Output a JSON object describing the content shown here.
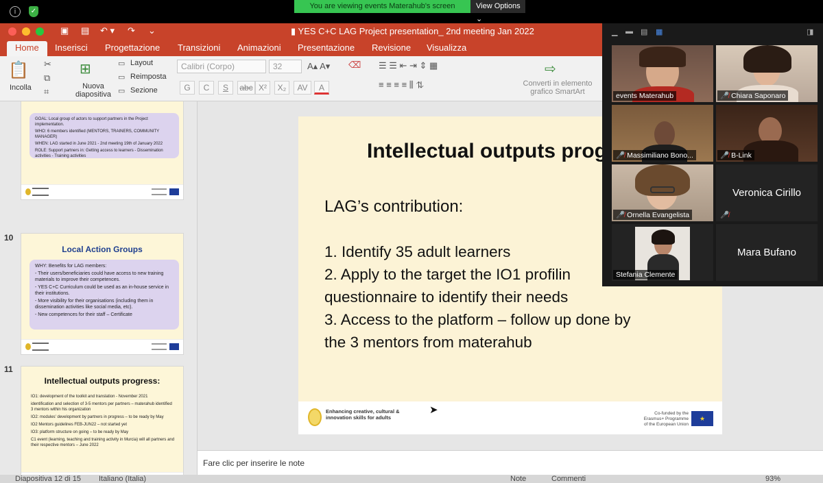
{
  "share_bar": {
    "message": "You are viewing events Materahub's screen",
    "view_options": "View Options"
  },
  "window": {
    "title": "YES C+C LAG Project presentation_ 2nd meeting Jan 2022"
  },
  "tabs": [
    "Home",
    "Inserisci",
    "Progettazione",
    "Transizioni",
    "Animazioni",
    "Presentazione",
    "Revisione",
    "Visualizza"
  ],
  "ribbon": {
    "paste": "Incolla",
    "new_slide": "Nuova diapositiva",
    "layout": "Layout",
    "reset": "Reimposta",
    "section": "Sezione",
    "font": "Calibri (Corpo)",
    "font_size": "32",
    "smartart": "Converti in elemento grafico SmartArt",
    "format_buttons": [
      "G",
      "C",
      "S",
      "abc",
      "X²",
      "X₂",
      "AV",
      "A"
    ]
  },
  "thumbnails": {
    "t9": {
      "goal": "GOAL: Local group of actors to support partners in the Project implementation.",
      "who": "WHO: 6 members identified (MENTORS, TRAINERS, COMMUNITY MANAGER)",
      "when": "WHEN: LAG started in June 2021 - 2nd meeting 19th of January 2022",
      "role": "ROLE: Support partners in: Getting access to learners - Dissemination activities - Training activities"
    },
    "t10": {
      "number": "10",
      "title": "Local Action Groups",
      "why": "WHY: Benefits for LAG members:",
      "b1": "- Their users/beneficiaries could have access to new training materials to improve their competences.",
      "b2": "- YES C+C Curriculum could be used as an in-house service in their institutions.",
      "b3": "- More visibility for their organisations (including them in dissemination activities like social media, etc).",
      "b4": "- New competences for their staff – Certificate"
    },
    "t11": {
      "number": "11",
      "title": "Intellectual outputs progress:",
      "items": [
        "IO1: development of the toolkit and translation - November 2021",
        "identification and selection of 3-5 mentors per partners – materahub identified 3 mentors within his organization",
        "IO2: modules' development by partners in progress – to be ready by May",
        "IO2 Mentors guidelines FEB-JUN22 – not started yet",
        "IO3: platform structure on going – to be ready by May",
        "C1 event (learning, teaching and training activity in Murcia) will all partners and their respective mentors – June 2022"
      ]
    }
  },
  "slide": {
    "title": "Intellectual outputs prog",
    "subtitle": "LAG’s contribution:",
    "items": [
      "1. Identify 35 adult learners",
      "2. Apply to the target the IO1 profilin",
      "questionnaire to identify their needs",
      "3. Access to the platform – follow up done by",
      "the 3 mentors from materahub"
    ],
    "footer_left": "Enhancing creative, cultural & innovation skills for adults",
    "footer_right": "Co-funded by the Erasmus+ Programme of the European Union"
  },
  "notes_placeholder": "Fare clic per inserire le note",
  "status_bar": {
    "slide": "Diapositiva 12 di 15",
    "lang": "Italiano (Italia)",
    "notes": "Note",
    "comments": "Commenti",
    "zoom": "93%"
  },
  "participants": [
    {
      "name": "events Materahub",
      "muted": false,
      "video": true
    },
    {
      "name": "Chiara Saponaro",
      "muted": true,
      "video": true
    },
    {
      "name": "Massimiliano Bono...",
      "muted": true,
      "video": true
    },
    {
      "name": "B-Link",
      "muted": true,
      "video": true
    },
    {
      "name": "Ornella Evangelista",
      "muted": true,
      "video": true
    },
    {
      "name": "Veronica Cirillo",
      "muted": true,
      "video": false
    },
    {
      "name": "Stefania Clemente",
      "muted": false,
      "video": true
    },
    {
      "name": "Mara Bufano",
      "muted": false,
      "video": false
    }
  ],
  "colors": {
    "ppt_accent": "#c8432a",
    "zoom_share_green": "#37c552",
    "active_speaker": "#c3d97a"
  }
}
